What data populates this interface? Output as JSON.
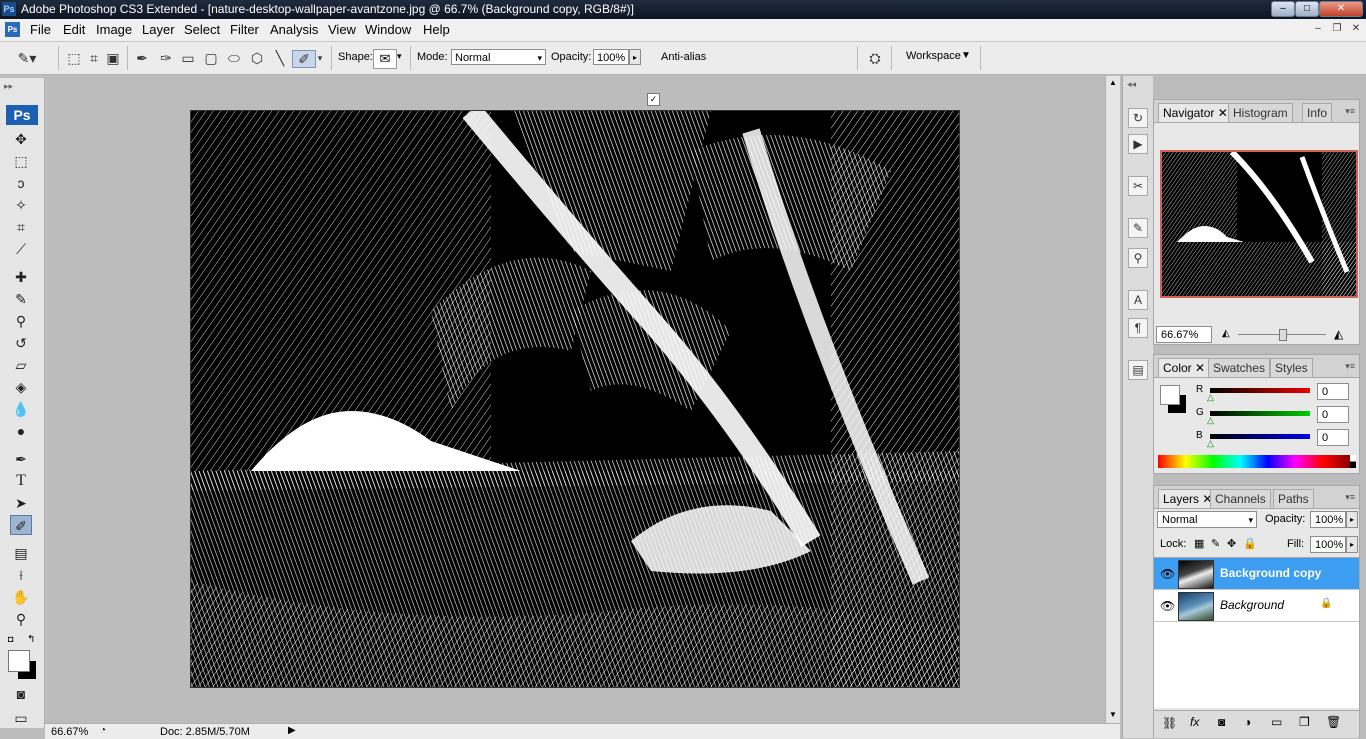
{
  "window": {
    "title": "Adobe Photoshop CS3 Extended - [nature-desktop-wallpaper-avantzone.jpg @ 66.7% (Background copy, RGB/8#)]",
    "app_badge": "Ps"
  },
  "menu": {
    "items": [
      "File",
      "Edit",
      "Image",
      "Layer",
      "Select",
      "Filter",
      "Analysis",
      "View",
      "Window",
      "Help"
    ]
  },
  "options": {
    "shape_label": "Shape:",
    "mode_label": "Mode:",
    "mode_value": "Normal",
    "opacity_label": "Opacity:",
    "opacity_value": "100%",
    "antialias_label": "Anti-alias",
    "antialias_checked": true,
    "workspace_label": "Workspace"
  },
  "toolbox": {
    "logo": "Ps",
    "text_tool_glyph": "T"
  },
  "status": {
    "zoom": "66.67%",
    "doc_info": "Doc: 2.85M/5.70M"
  },
  "navigator": {
    "tabs": [
      "Navigator",
      "Histogram",
      "Info"
    ],
    "zoom": "66.67%",
    "zoom_level": 0.5
  },
  "color_panel": {
    "tabs": [
      "Color",
      "Swatches",
      "Styles"
    ],
    "channels": [
      {
        "label": "R",
        "value": "0",
        "color": "#d11"
      },
      {
        "label": "G",
        "value": "0",
        "color": "#1a1"
      },
      {
        "label": "B",
        "value": "0",
        "color": "#11a"
      }
    ]
  },
  "layers_panel": {
    "tabs": [
      "Layers",
      "Channels",
      "Paths"
    ],
    "blend_mode": "Normal",
    "opacity_label": "Opacity:",
    "opacity_value": "100%",
    "lock_label": "Lock:",
    "fill_label": "Fill:",
    "fill_value": "100%",
    "layers": [
      {
        "name": "Background copy",
        "selected": true,
        "locked": false
      },
      {
        "name": "Background",
        "selected": false,
        "locked": true
      }
    ]
  },
  "colors": {
    "selection": "#3d9df0",
    "title_bar": "#0d1522"
  }
}
